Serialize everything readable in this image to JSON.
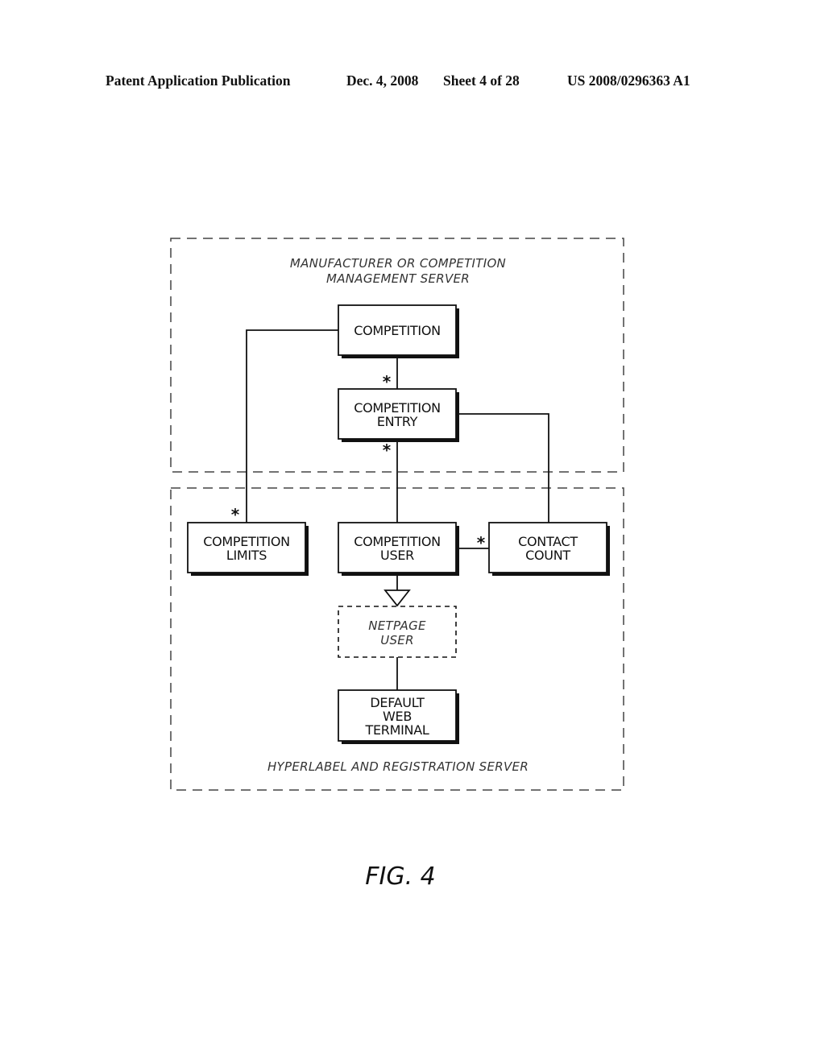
{
  "header": {
    "publication": "Patent Application Publication",
    "date": "Dec. 4, 2008",
    "sheet": "Sheet 4 of 28",
    "number": "US 2008/0296363 A1"
  },
  "diagram": {
    "regions": {
      "top": {
        "label_line1": "MANUFACTURER OR COMPETITION",
        "label_line2": "MANAGEMENT SERVER"
      },
      "bottom": {
        "label": "HYPERLABEL AND REGISTRATION SERVER"
      }
    },
    "classes": {
      "competition": {
        "line1": "COMPETITION"
      },
      "competition_entry": {
        "line1": "COMPETITION",
        "line2": "ENTRY"
      },
      "competition_limits": {
        "line1": "COMPETITION",
        "line2": "LIMITS"
      },
      "competition_user": {
        "line1": "COMPETITION",
        "line2": "USER"
      },
      "contact_count": {
        "line1": "CONTACT",
        "line2": "COUNT"
      },
      "netpage_user": {
        "line1": "NETPAGE",
        "line2": "USER"
      },
      "default_web_terminal": {
        "line1": "DEFAULT",
        "line2": "WEB",
        "line3": "TERMINAL"
      }
    },
    "multiplicity_symbol": "*",
    "relationships": [
      {
        "from": "COMPETITION",
        "to": "COMPETITION ENTRY",
        "multiplicity": "*"
      },
      {
        "from": "COMPETITION",
        "to": "COMPETITION LIMITS",
        "multiplicity": "*"
      },
      {
        "from": "COMPETITION ENTRY",
        "to": "COMPETITION USER",
        "multiplicity": "*"
      },
      {
        "from": "COMPETITION ENTRY",
        "to": "CONTACT COUNT",
        "multiplicity": ""
      },
      {
        "from": "COMPETITION USER",
        "to": "CONTACT COUNT",
        "multiplicity": "*"
      },
      {
        "from": "COMPETITION USER",
        "to": "NETPAGE USER",
        "type": "generalization"
      },
      {
        "from": "NETPAGE USER",
        "to": "DEFAULT WEB TERMINAL",
        "multiplicity": ""
      }
    ]
  },
  "caption": "FIG. 4"
}
